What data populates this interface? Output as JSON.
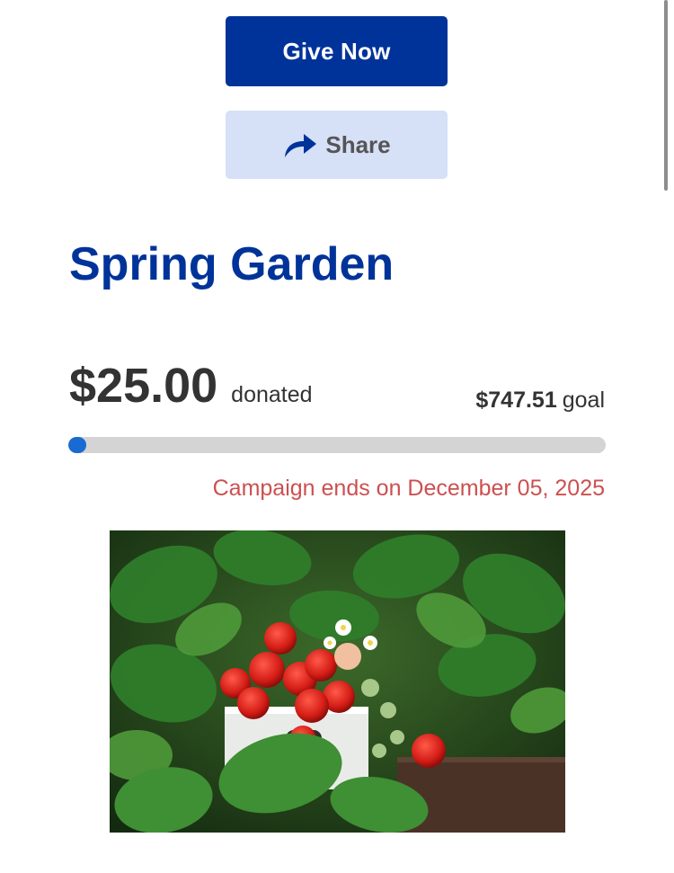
{
  "actions": {
    "give_label": "Give Now",
    "share_label": "Share"
  },
  "campaign": {
    "title": "Spring Garden",
    "raised": "$25.00",
    "raised_suffix": "donated",
    "goal_amount": "$747.51",
    "goal_suffix": "goal",
    "progress_fraction": 0.033,
    "ends_text": "Campaign ends on December 05, 2025"
  },
  "image": {
    "alt": "strawberries in a white crate among strawberry plants"
  },
  "colors": {
    "primary": "#003399",
    "share_bg": "#d6e0f7",
    "progress_fill": "#1a6ad3",
    "progress_track": "#d4d4d4",
    "deadline": "#cc5050"
  },
  "icons": {
    "share": "share-arrow-icon"
  }
}
